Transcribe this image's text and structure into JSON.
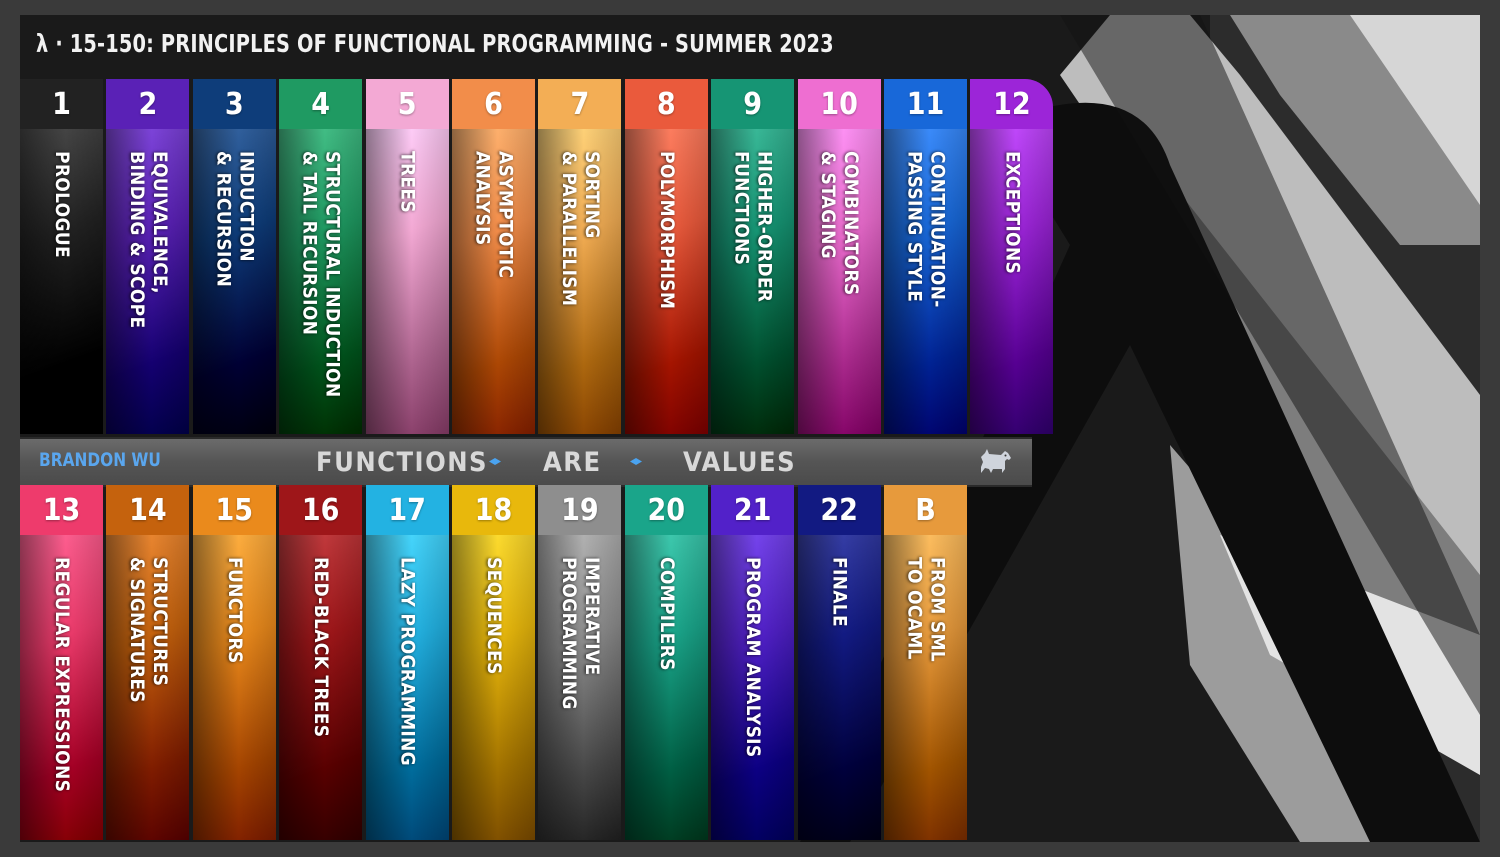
{
  "header": {
    "title": "λ · 15-150: PRINCIPLES OF FUNCTIONAL PROGRAMMING - SUMMER 2023"
  },
  "divider": {
    "author": "BRANDON WU",
    "motto": [
      "FUNCTIONS",
      "ARE",
      "VALUES"
    ],
    "icons": [
      "diamond-icon",
      "diamond-icon",
      "scottie-dog-icon"
    ]
  },
  "lectures_top": [
    {
      "num": "1",
      "title": "PROLOGUE",
      "color": "#222222"
    },
    {
      "num": "2",
      "title": "EQUIVALENCE,\nBINDING & SCOPE",
      "color": "#5a21b6"
    },
    {
      "num": "3",
      "title": "INDUCTION\n& RECURSION",
      "color": "#0e3d7a"
    },
    {
      "num": "4",
      "title": "STRUCTURAL INDUCTION\n& TAIL RECURSION",
      "color": "#1f9a62"
    },
    {
      "num": "5",
      "title": "TREES",
      "color": "#f3a9d4"
    },
    {
      "num": "6",
      "title": "ASYMPTOTIC\nANALYSIS",
      "color": "#f28d4a"
    },
    {
      "num": "7",
      "title": "SORTING\n& PARALLELISM",
      "color": "#f3ae55"
    },
    {
      "num": "8",
      "title": "POLYMORPHISM",
      "color": "#ea5a3c"
    },
    {
      "num": "9",
      "title": "HIGHER-ORDER\nFUNCTIONS",
      "color": "#169574"
    },
    {
      "num": "10",
      "title": "COMBINATORS\n& STAGING",
      "color": "#ee6ed1"
    },
    {
      "num": "11",
      "title": "CONTINUATION-\nPASSING STYLE",
      "color": "#1868d9"
    },
    {
      "num": "12",
      "title": "EXCEPTIONS",
      "color": "#9c25d8"
    }
  ],
  "lectures_bottom": [
    {
      "num": "13",
      "title": "REGULAR EXPRESSIONS",
      "color": "#ee3b6c"
    },
    {
      "num": "14",
      "title": "STRUCTURES\n& SIGNATURES",
      "color": "#c5620d"
    },
    {
      "num": "15",
      "title": "FUNCTORS",
      "color": "#ea8a1c"
    },
    {
      "num": "16",
      "title": "RED-BLACK TREES",
      "color": "#9e1619"
    },
    {
      "num": "17",
      "title": "LAZY PROGRAMMING",
      "color": "#23b2e2"
    },
    {
      "num": "18",
      "title": "SEQUENCES",
      "color": "#e8b80c"
    },
    {
      "num": "19",
      "title": "IMPERATIVE\nPROGRAMMING",
      "color": "#8e8e8e"
    },
    {
      "num": "20",
      "title": "COMPILERS",
      "color": "#1aa58a"
    },
    {
      "num": "21",
      "title": "PROGRAM ANALYSIS",
      "color": "#5221c9"
    },
    {
      "num": "22",
      "title": "FINALE",
      "color": "#121a82"
    },
    {
      "num": "B",
      "title": "FROM SML\nTO OCAML",
      "color": "#e79a3c"
    }
  ]
}
